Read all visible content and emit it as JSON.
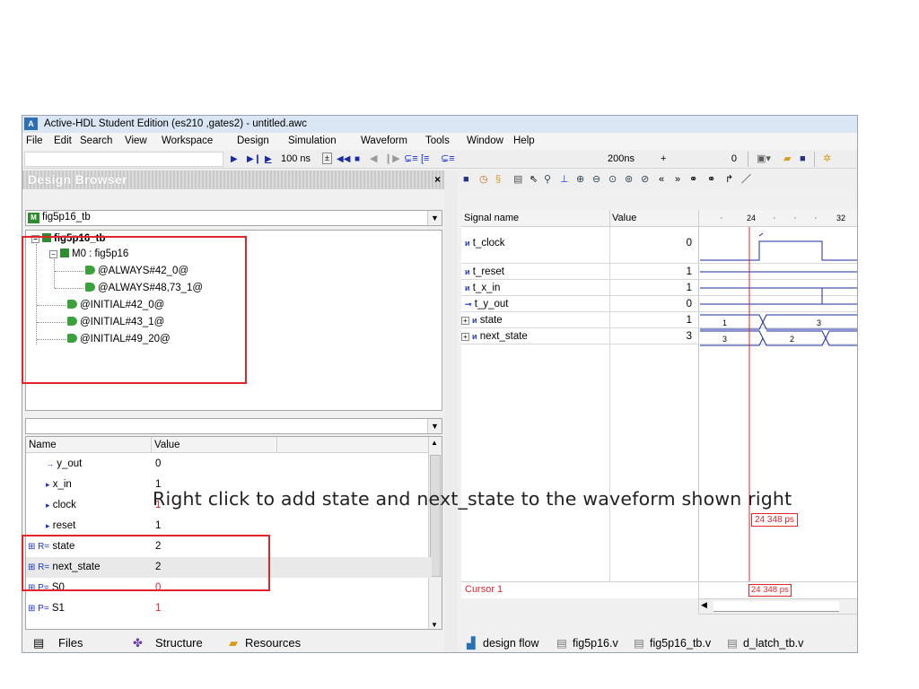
{
  "window": {
    "title": "Active-HDL Student Edition (es210 ,gates2) - untitled.awc",
    "app_icon": "A"
  },
  "menu": [
    "File",
    "Edit",
    "Search",
    "View",
    "Workspace",
    "Design",
    "Simulation",
    "Waveform",
    "Tools",
    "Window",
    "Help"
  ],
  "toolbar": {
    "sim_step": "100 ns",
    "sim_time": "200ns",
    "zero": "0",
    "plus": "+"
  },
  "design_browser": {
    "title": "Design Browser",
    "close": "×",
    "top_level": "fig5p16_tb",
    "tree": [
      {
        "label": "fig5p16_tb"
      },
      {
        "label": "M0 : fig5p16"
      },
      {
        "label": "@ALWAYS#42_0@"
      },
      {
        "label": "@ALWAYS#48,73_1@"
      },
      {
        "label": "@INITIAL#42_0@"
      },
      {
        "label": "@INITIAL#43_1@"
      },
      {
        "label": "@INITIAL#49_20@"
      }
    ],
    "columns": {
      "name": "Name",
      "value": "Value"
    },
    "objects": [
      {
        "prefix": "→",
        "name": "y_out",
        "value": "0"
      },
      {
        "prefix": "▸",
        "name": "x_in",
        "value": "1"
      },
      {
        "prefix": "▸",
        "name": "clock",
        "value": "1"
      },
      {
        "prefix": "▸",
        "name": "reset",
        "value": "1"
      },
      {
        "prefix": "⊞ R=",
        "name": "state",
        "value": "2"
      },
      {
        "prefix": "⊞ R=",
        "name": "next_state",
        "value": "2"
      },
      {
        "prefix": "⊞ P=",
        "name": "S0",
        "value": "0"
      },
      {
        "prefix": "⊞ P=",
        "name": "S1",
        "value": "1"
      }
    ],
    "tabs": [
      "Files",
      "Structure",
      "Resources"
    ]
  },
  "waveform": {
    "columns": {
      "signal": "Signal name",
      "value": "Value"
    },
    "ticks": [
      "24",
      "32"
    ],
    "signals": [
      {
        "name": "t_clock",
        "value": "0"
      },
      {
        "name": "t_reset",
        "value": "1"
      },
      {
        "name": "t_x_in",
        "value": "1"
      },
      {
        "name": "t_y_out",
        "value": "0"
      },
      {
        "name": "state",
        "value": "1"
      },
      {
        "name": "next_state",
        "value": "3"
      }
    ],
    "bus_labels": {
      "state": [
        "1",
        "3"
      ],
      "next_state": [
        "3",
        "2"
      ]
    },
    "cursor_label": "Cursor 1",
    "cursor_time": "24 348 ps",
    "tabs": [
      "design flow",
      "fig5p16.v",
      "fig5p16_tb.v",
      "d_latch_tb.v"
    ]
  },
  "annotation": {
    "text": "Right click to add state and next_state to the waveform shown right",
    "color": "#e0242a"
  }
}
